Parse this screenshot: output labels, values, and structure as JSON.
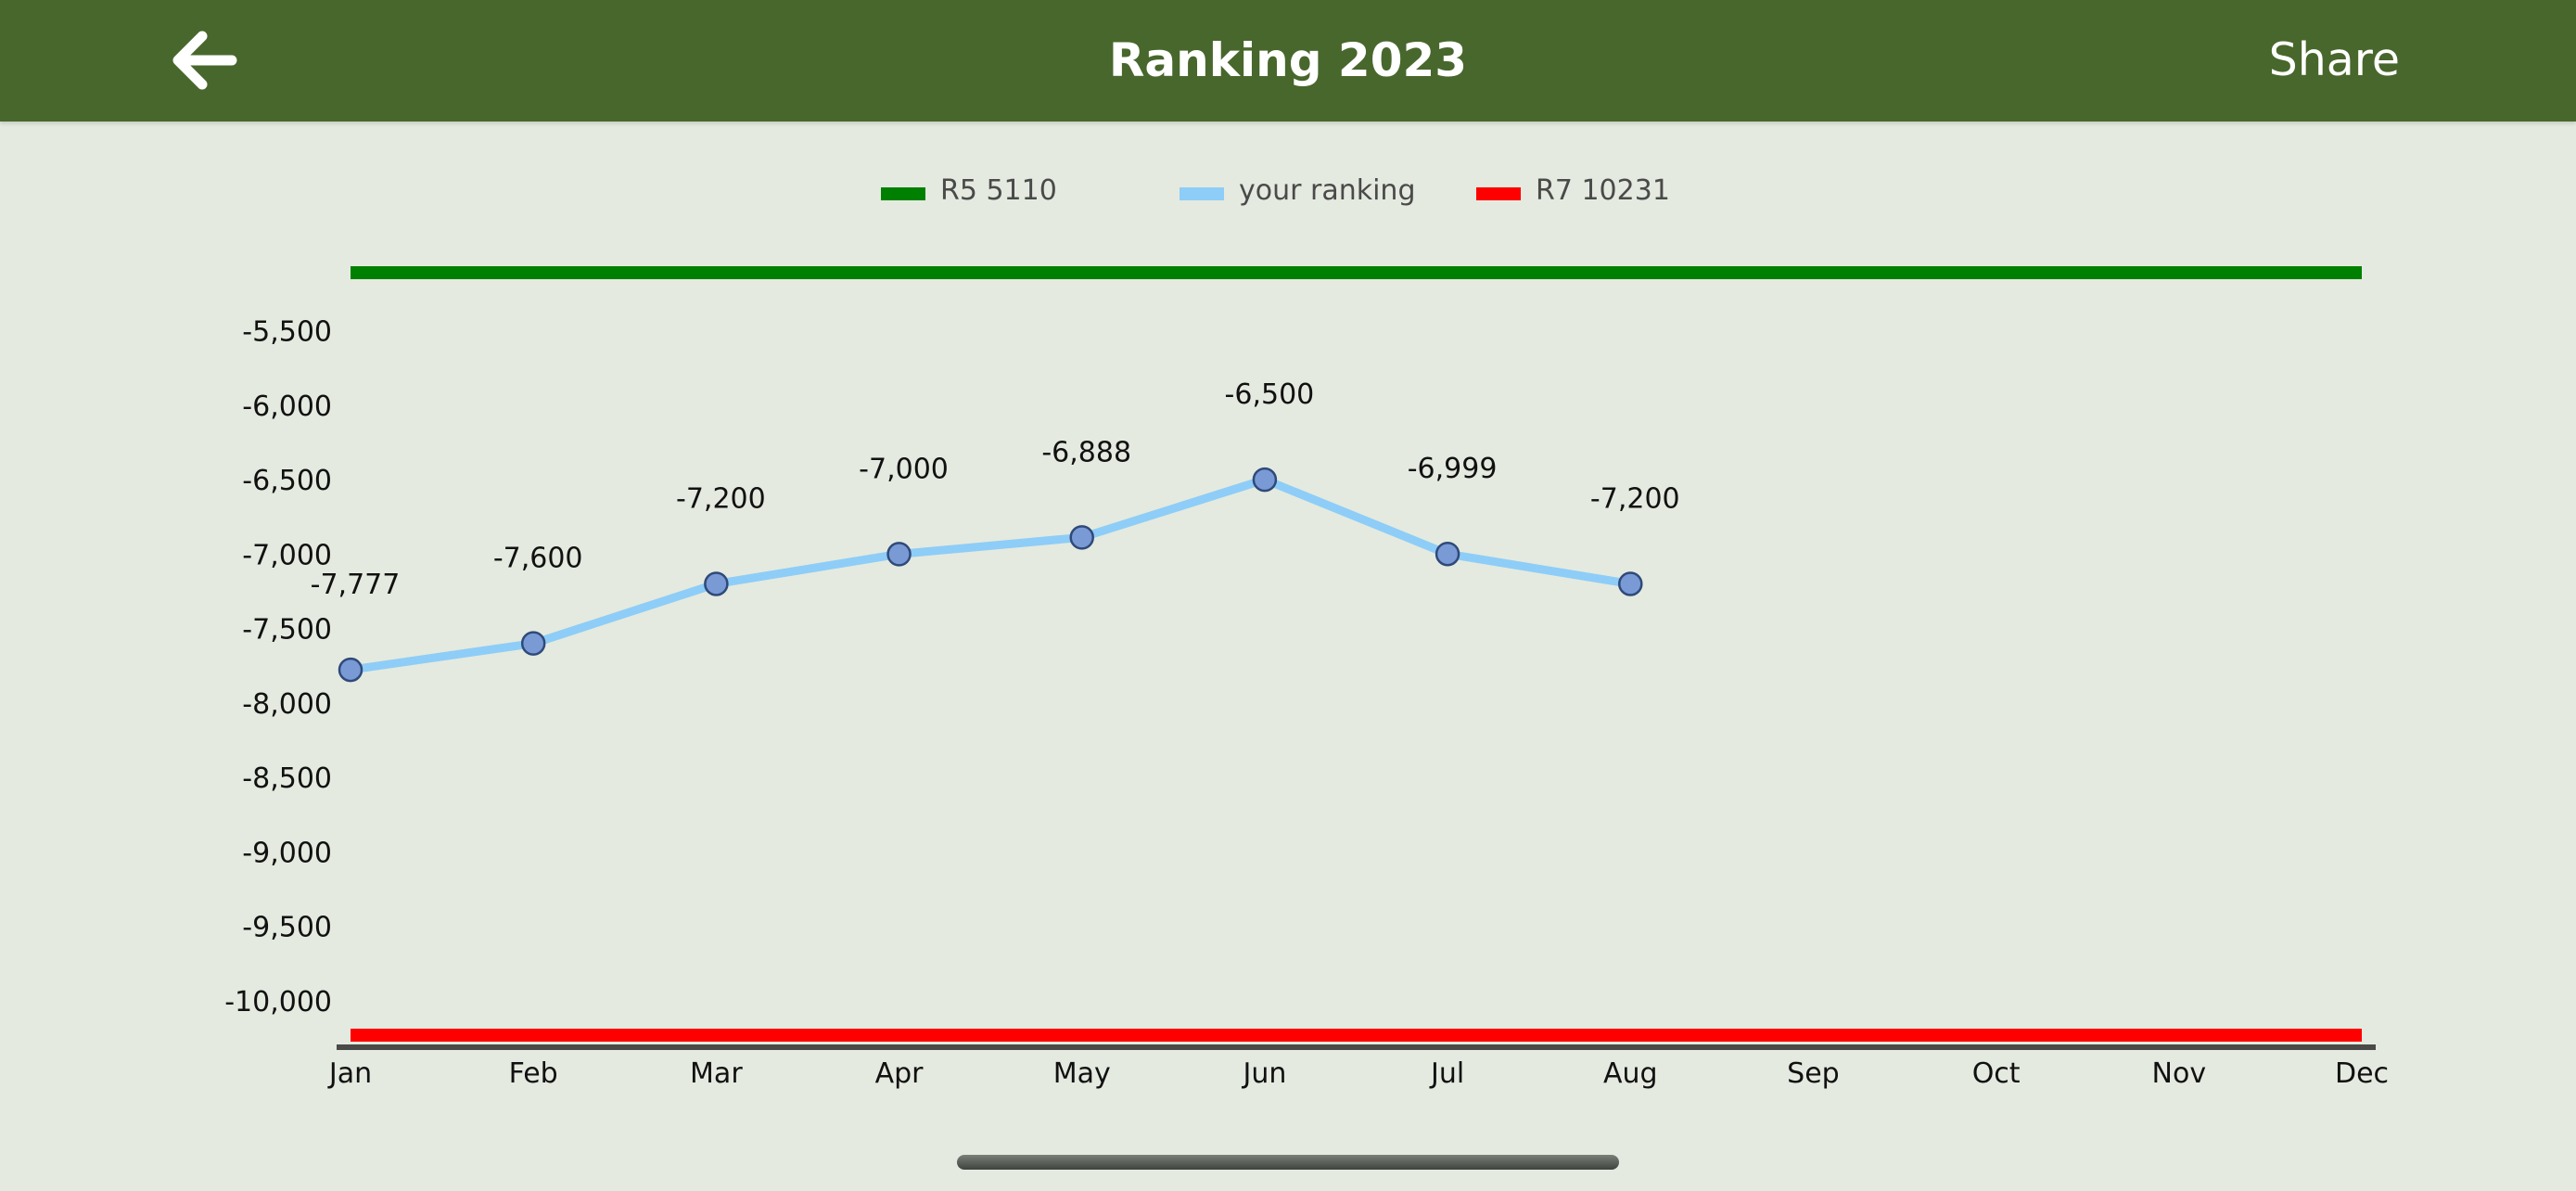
{
  "header": {
    "title": "Ranking 2023",
    "share_label": "Share",
    "back_icon": "arrow-left-icon",
    "background": "#48672c"
  },
  "chart_data": {
    "type": "line",
    "title": "",
    "xlabel": "",
    "ylabel": "",
    "categories": [
      "Jan",
      "Feb",
      "Mar",
      "Apr",
      "May",
      "Jun",
      "Jul",
      "Aug",
      "Sep",
      "Oct",
      "Nov",
      "Dec"
    ],
    "y_ticks": [
      -5500,
      -6000,
      -6500,
      -7000,
      -7500,
      -8000,
      -8500,
      -9000,
      -9500,
      -10000
    ],
    "y_tick_labels": [
      "-5,500",
      "-6,000",
      "-6,500",
      "-7,000",
      "-7,500",
      "-8,000",
      "-8,500",
      "-9,000",
      "-9,500",
      "-10,000"
    ],
    "ylim": [
      -10250,
      -5110
    ],
    "grid": false,
    "legend_position": "top-center",
    "series": [
      {
        "name": "R5 5110",
        "type": "reference",
        "color": "#008000",
        "value": -5110
      },
      {
        "name": "your ranking",
        "type": "line",
        "color": "#8ecdf7",
        "marker_color": "#7a9ad6",
        "values": [
          -7777,
          -7600,
          -7200,
          -7000,
          -6888,
          -6500,
          -6999,
          -7200
        ],
        "labels": [
          "-7,777",
          "-7,600",
          "-7,200",
          "-7,000",
          "-6,888",
          "-6,500",
          "-6,999",
          "-7,200"
        ]
      },
      {
        "name": "R7 10231",
        "type": "reference",
        "color": "#ff0000",
        "value": -10231
      }
    ]
  }
}
